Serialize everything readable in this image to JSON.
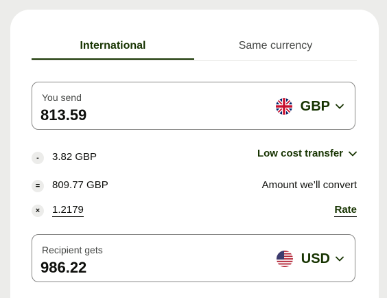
{
  "tabs": {
    "international": "International",
    "same_currency": "Same currency"
  },
  "send": {
    "label": "You send",
    "amount": "813.59",
    "currency": "GBP",
    "flag_icon": "uk-flag-icon"
  },
  "fees": {
    "fee_symbol": "-",
    "fee_amount": "3.82 GBP",
    "fee_option": "Low cost transfer",
    "convert_symbol": "=",
    "convert_amount": "809.77 GBP",
    "convert_label": "Amount we’ll convert",
    "rate_symbol": "×",
    "rate_value": "1.2179",
    "rate_label": "Rate"
  },
  "receive": {
    "label": "Recipient gets",
    "amount": "986.22",
    "currency": "USD",
    "flag_icon": "us-flag-icon"
  },
  "colors": {
    "brand": "#163300",
    "background": "#ececea",
    "border": "#868685"
  }
}
